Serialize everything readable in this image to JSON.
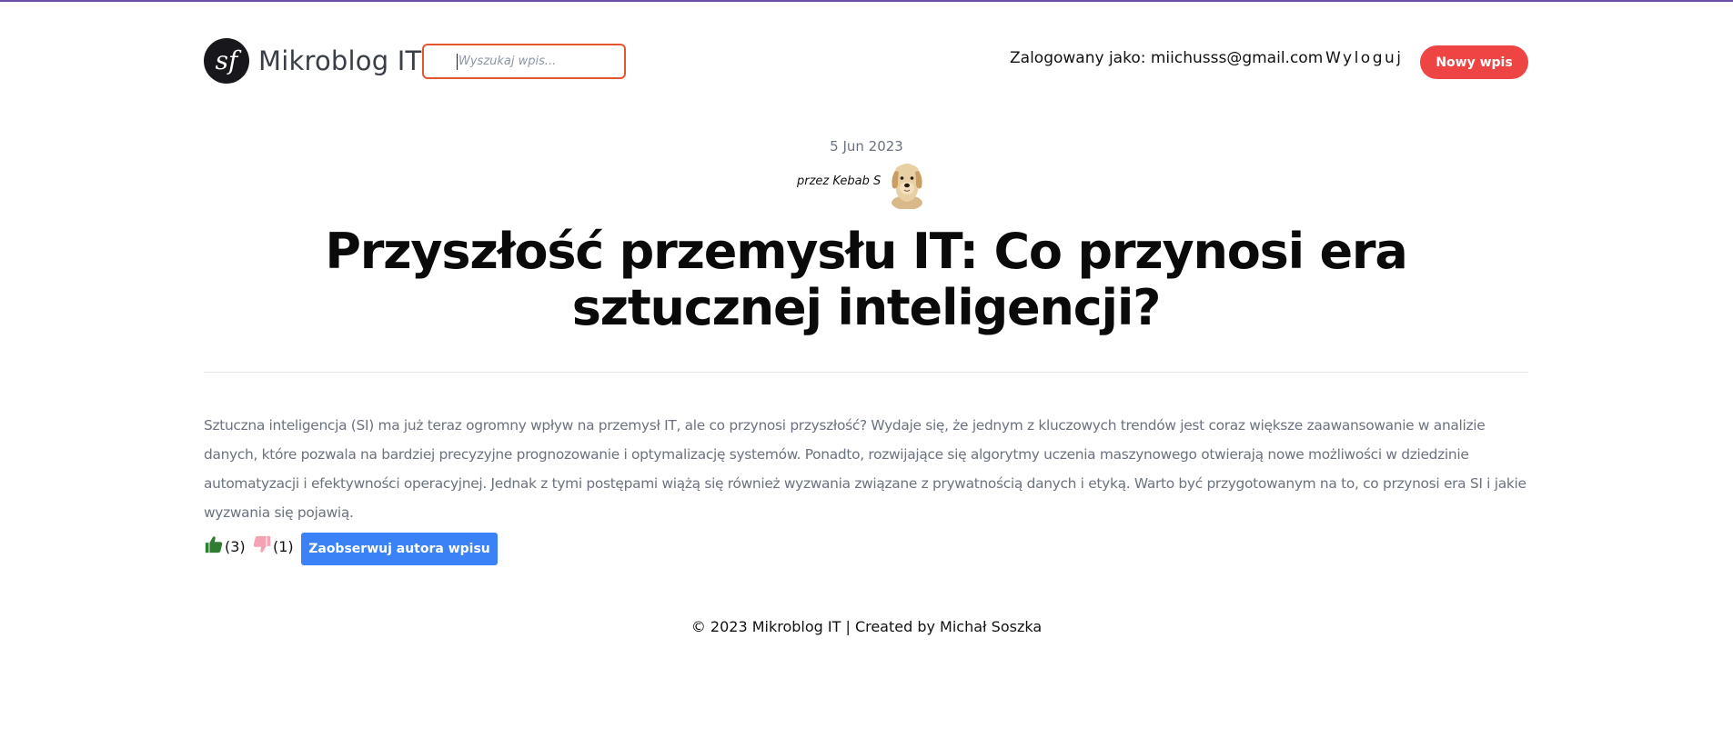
{
  "header": {
    "logo_text": "Mikroblog IT",
    "search_placeholder": "Wyszukaj wpis...",
    "user_info": "Zalogowany jako: miichusss@gmail.com",
    "logout_label": "Wyloguj",
    "new_post_label": "Nowy wpis"
  },
  "post": {
    "date": "5 Jun 2023",
    "author_label": "przez Kebab S",
    "title": "Przyszłość przemysłu IT: Co przynosi era sztucznej inteligencji?",
    "content": "Sztuczna inteligencja (SI) ma już teraz ogromny wpływ na przemysł IT, ale co przynosi przyszłość? Wydaje się, że jednym z kluczowych trendów jest coraz większe zaawansowanie w analizie danych, które pozwala na bardziej precyzyjne prognozowanie i optymalizację systemów. Ponadto, rozwijające się algorytmy uczenia maszynowego otwierają nowe możliwości w dziedzinie automatyzacji i efektywności operacyjnej. Jednak z tymi postępami wiążą się również wyzwania związane z prywatnością danych i etyką. Warto być przygotowanym na to, co przynosi era SI i jakie wyzwania się pojawią.",
    "likes": "(3)",
    "dislikes": "(1)",
    "follow_label": "Zaobserwuj autora wpisu"
  },
  "footer": {
    "text": "© 2023 Mikroblog IT | Created by Michał Soszka"
  },
  "colors": {
    "accent_red": "#ef4444",
    "search_border": "#e4572e",
    "follow_blue": "#3b82f6",
    "like_green": "#2e7d32",
    "dislike_pink": "#f4a3b5",
    "top_bar": "#6b4ea3"
  },
  "icons": {
    "logo": "symfony-logo-icon",
    "like": "thumbs-up-icon",
    "dislike": "thumbs-down-icon"
  }
}
